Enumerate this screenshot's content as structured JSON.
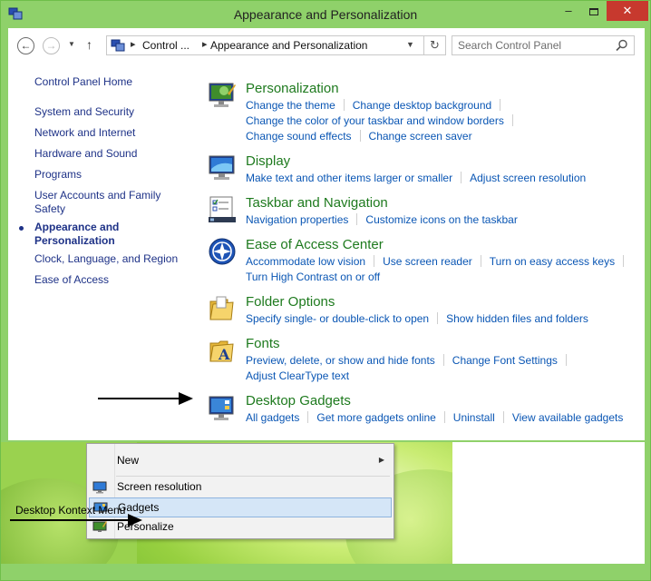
{
  "window": {
    "title": "Appearance and Personalization",
    "controls": {
      "minimize": "–",
      "close": "✕"
    }
  },
  "navbar": {
    "breadcrumb": [
      "Control ...",
      "Appearance and Personalization"
    ],
    "search_placeholder": "Search Control Panel"
  },
  "sidebar": {
    "items": [
      {
        "label": "Control Panel Home"
      },
      {
        "label": "System and Security"
      },
      {
        "label": "Network and Internet"
      },
      {
        "label": "Hardware and Sound"
      },
      {
        "label": "Programs"
      },
      {
        "label": "User Accounts and Family Safety"
      },
      {
        "label": "Appearance and Personalization",
        "active": true
      },
      {
        "label": "Clock, Language, and Region"
      },
      {
        "label": "Ease of Access"
      }
    ]
  },
  "categories": [
    {
      "title": "Personalization",
      "icon": "personalization-icon",
      "links": [
        [
          "Change the theme",
          "Change desktop background"
        ],
        [
          "Change the color of your taskbar and window borders"
        ],
        [
          "Change sound effects",
          "Change screen saver"
        ]
      ]
    },
    {
      "title": "Display",
      "icon": "display-icon",
      "links": [
        [
          "Make text and other items larger or smaller",
          "Adjust screen resolution"
        ]
      ]
    },
    {
      "title": "Taskbar and Navigation",
      "icon": "taskbar-icon",
      "links": [
        [
          "Navigation properties",
          "Customize icons on the taskbar"
        ]
      ]
    },
    {
      "title": "Ease of Access Center",
      "icon": "ease-of-access-icon",
      "links": [
        [
          "Accommodate low vision",
          "Use screen reader",
          "Turn on easy access keys"
        ],
        [
          "Turn High Contrast on or off"
        ]
      ]
    },
    {
      "title": "Folder Options",
      "icon": "folder-icon",
      "links": [
        [
          "Specify single- or double-click to open",
          "Show hidden files and folders"
        ]
      ]
    },
    {
      "title": "Fonts",
      "icon": "fonts-icon",
      "links": [
        [
          "Preview, delete, or show and hide fonts",
          "Change Font Settings"
        ],
        [
          "Adjust ClearType text"
        ]
      ]
    },
    {
      "title": "Desktop Gadgets",
      "icon": "gadgets-icon",
      "links": [
        [
          "All gadgets",
          "Get more gadgets online",
          "Uninstall",
          "View available gadgets"
        ]
      ]
    }
  ],
  "context_menu": {
    "items": [
      {
        "label": "New",
        "submenu": true
      },
      {
        "label": "Screen resolution"
      },
      {
        "label": "Gadgets",
        "highlighted": true
      },
      {
        "label": "Personalize"
      }
    ]
  },
  "annotation": {
    "label": "Desktop Kontext Menu"
  },
  "colors": {
    "frame": "#8fd16a",
    "link": "#0a56b4",
    "category_title": "#1e7a1e",
    "sidebar_text": "#1e3287",
    "close_button": "#c7392e"
  }
}
